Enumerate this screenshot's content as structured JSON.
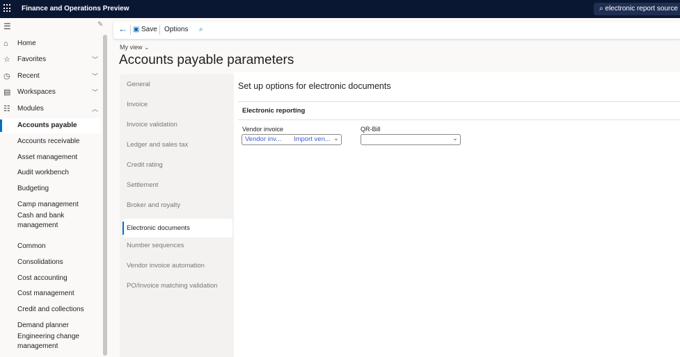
{
  "header": {
    "app_title": "Finance and Operations Preview",
    "search_text": "electronic report source"
  },
  "nav": {
    "items": [
      {
        "label": "Home",
        "icon": "home-icon"
      },
      {
        "label": "Favorites",
        "icon": "star-icon",
        "chevron": "down"
      },
      {
        "label": "Recent",
        "icon": "clock-icon",
        "chevron": "down"
      },
      {
        "label": "Workspaces",
        "icon": "workspace-icon",
        "chevron": "down"
      },
      {
        "label": "Modules",
        "icon": "list-icon",
        "chevron": "up"
      }
    ],
    "modules": [
      "Accounts payable",
      "Accounts receivable",
      "Asset management",
      "Audit workbench",
      "Budgeting",
      "Camp management",
      "Cash and bank management",
      "Common",
      "Consolidations",
      "Cost accounting",
      "Cost management",
      "Credit and collections",
      "Demand planner",
      "Engineering change management"
    ],
    "selected_module": "Accounts payable"
  },
  "toolbar": {
    "save": "Save",
    "options": "Options"
  },
  "page": {
    "view": "My view",
    "title": "Accounts payable parameters"
  },
  "tabs": [
    "General",
    "Invoice",
    "Invoice validation",
    "Ledger and sales tax",
    "Credit rating",
    "Settlement",
    "Broker and royalty",
    "Electronic documents",
    "Number sequences",
    "Vendor invoice automation",
    "PO/Invoice matching validation"
  ],
  "selected_tab": "Electronic documents",
  "content": {
    "heading": "Set up options for electronic documents",
    "section": "Electronic reporting",
    "vendor_invoice": {
      "label": "Vendor invoice",
      "value1": "Vendor inv...",
      "value2": "Import ven..."
    },
    "qr_bill": {
      "label": "QR-Bill",
      "value": ""
    }
  }
}
